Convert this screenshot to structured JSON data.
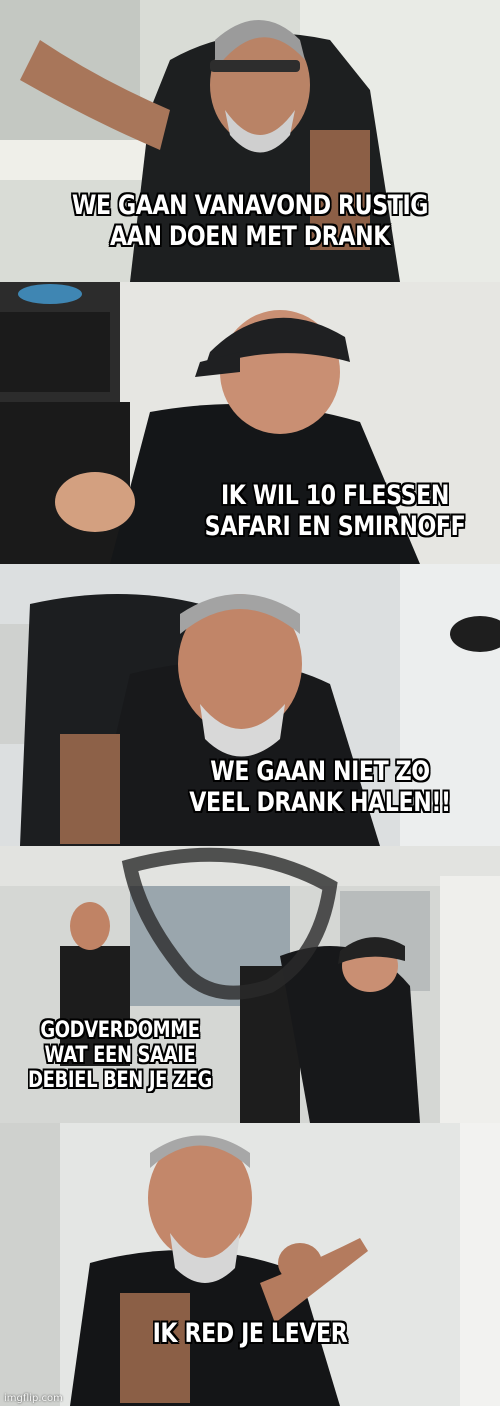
{
  "panels": [
    {
      "caption": "WE GAAN VANAVOND RUSTIG\nAAN DOEN MET DRANK"
    },
    {
      "caption": "IK WIL 10 FLESSEN\nSAFARI EN SMIRNOFF"
    },
    {
      "caption": "WE GAAN NIET ZO\nVEEL DRANK HALEN!!"
    },
    {
      "caption": "GODVERDOMME\nWAT EEN SAAIE\nDEBIEL BEN JE ZEG"
    },
    {
      "caption": "IK RED JE LEVER"
    }
  ],
  "watermark": "imgflip.com"
}
